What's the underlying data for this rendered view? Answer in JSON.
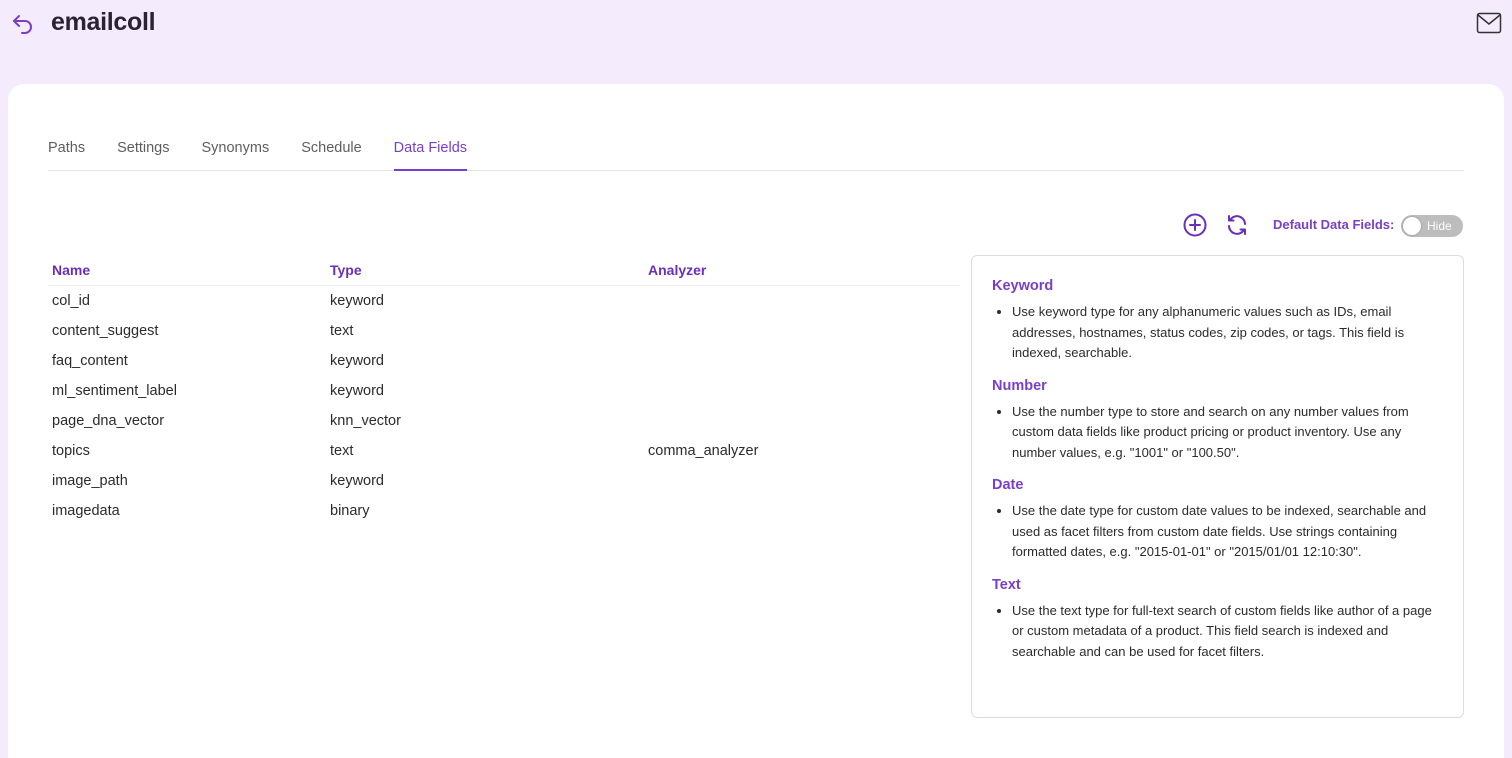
{
  "header": {
    "title": "emailcoll",
    "back_icon": "undo-arrow-icon",
    "mail_icon": "envelope-icon"
  },
  "tabs": [
    {
      "label": "Paths",
      "active": false
    },
    {
      "label": "Settings",
      "active": false
    },
    {
      "label": "Synonyms",
      "active": false
    },
    {
      "label": "Schedule",
      "active": false
    },
    {
      "label": "Data Fields",
      "active": true
    }
  ],
  "toolbar": {
    "add_icon": "plus-circle-icon",
    "refresh_icon": "refresh-icon",
    "default_fields_label": "Default Data Fields:",
    "toggle_label": "Hide",
    "toggle_on": false
  },
  "table": {
    "columns": [
      "Name",
      "Type",
      "Analyzer"
    ],
    "rows": [
      {
        "name": "col_id",
        "type": "keyword",
        "analyzer": ""
      },
      {
        "name": "content_suggest",
        "type": "text",
        "analyzer": ""
      },
      {
        "name": "faq_content",
        "type": "keyword",
        "analyzer": ""
      },
      {
        "name": "ml_sentiment_label",
        "type": "keyword",
        "analyzer": ""
      },
      {
        "name": "page_dna_vector",
        "type": "knn_vector",
        "analyzer": ""
      },
      {
        "name": "topics",
        "type": "text",
        "analyzer": "comma_analyzer"
      },
      {
        "name": "image_path",
        "type": "keyword",
        "analyzer": ""
      },
      {
        "name": "imagedata",
        "type": "binary",
        "analyzer": ""
      }
    ]
  },
  "help": [
    {
      "heading": "Keyword",
      "text": "Use keyword type for any alphanumeric values such as IDs, email addresses, hostnames, status codes, zip codes, or tags. This field is indexed, searchable."
    },
    {
      "heading": "Number",
      "text": "Use the number type to store and search on any number values from custom data fields like product pricing or product inventory. Use any number values, e.g. \"1001\" or \"100.50\"."
    },
    {
      "heading": "Date",
      "text": "Use the date type for custom date values to be indexed, searchable and used as facet filters from custom date fields. Use strings containing formatted dates, e.g. \"2015-01-01\" or \"2015/01/01 12:10:30\"."
    },
    {
      "heading": "Text",
      "text": "Use the text type for full-text search of custom fields like author of a page or custom metadata of a product. This field search is indexed and searchable and can be used for facet filters."
    }
  ],
  "colors": {
    "accent": "#7a3fc8",
    "header_bg": "#f4ebfd",
    "toggle_off": "#bdbdbd"
  }
}
